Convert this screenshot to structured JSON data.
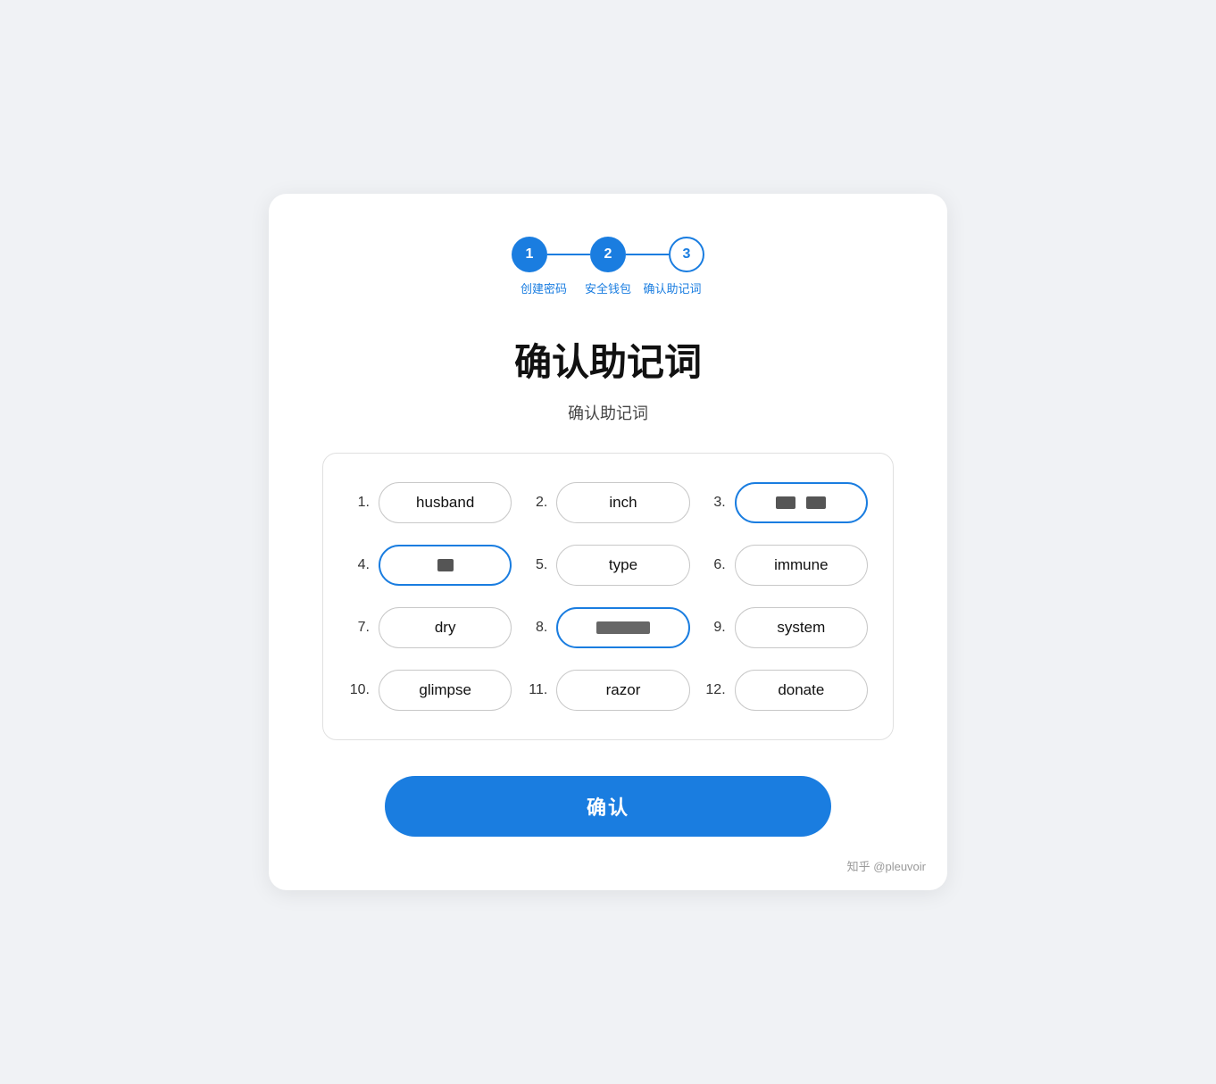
{
  "stepper": {
    "steps": [
      {
        "number": "1",
        "label": "创建密码",
        "style": "active"
      },
      {
        "number": "2",
        "label": "安全钱包",
        "style": "active"
      },
      {
        "number": "3",
        "label": "确认助记词",
        "style": "outline"
      }
    ]
  },
  "title": "确认助记词",
  "subtitle": "确认助记词",
  "words": [
    {
      "number": "1.",
      "word": "husband",
      "highlighted": false,
      "redacted": false
    },
    {
      "number": "2.",
      "word": "inch",
      "highlighted": false,
      "redacted": false
    },
    {
      "number": "3.",
      "word": "",
      "highlighted": true,
      "redacted": true
    },
    {
      "number": "4.",
      "word": "",
      "highlighted": true,
      "redacted": true
    },
    {
      "number": "5.",
      "word": "type",
      "highlighted": false,
      "redacted": false
    },
    {
      "number": "6.",
      "word": "immune",
      "highlighted": false,
      "redacted": false
    },
    {
      "number": "7.",
      "word": "dry",
      "highlighted": false,
      "redacted": false
    },
    {
      "number": "8.",
      "word": "",
      "highlighted": true,
      "redacted": true
    },
    {
      "number": "9.",
      "word": "system",
      "highlighted": false,
      "redacted": false
    },
    {
      "number": "10.",
      "word": "glimpse",
      "highlighted": false,
      "redacted": false
    },
    {
      "number": "11.",
      "word": "razor",
      "highlighted": false,
      "redacted": false
    },
    {
      "number": "12.",
      "word": "donate",
      "highlighted": false,
      "redacted": false
    }
  ],
  "confirm_button": "确认",
  "watermark": "知乎 @pleuvoir"
}
